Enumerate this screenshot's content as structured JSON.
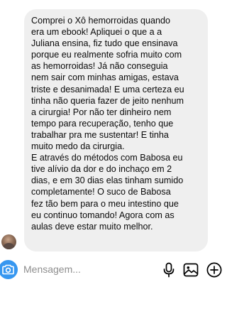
{
  "message": {
    "lines": [
      "Comprei o Xô hemorroidas quando",
      "era um ebook! Apliquei o que a a",
      "Juliana ensina, fiz tudo que ensinava",
      "porque eu realmente sofria muito com",
      "as hemorroidas! Já não conseguia",
      "nem sair com minhas amigas, estava",
      "triste e desanimada! E uma certeza eu",
      "tinha não queria fazer de jeito nenhum",
      "a cirurgia! Por não ter dinheiro nem",
      "tempo para recuperação, tenho que",
      "trabalhar pra me sustentar! E tinha",
      "muito medo da cirurgia.",
      "E através do métodos com Babosa eu",
      "tive alívio da dor e do inchaço em 2",
      "dias, e em 30 dias elas tinham sumido",
      "completamente! O suco de Babosa",
      "fez tão bem para o meu intestino que",
      "eu continuo tomando! Agora com as",
      "aulas deve estar muito melhor."
    ],
    "bubble_color": "#efefef"
  },
  "composer": {
    "placeholder": "Mensagem...",
    "camera_icon": "camera-icon",
    "accent_color": "#3797f0",
    "right_icons": [
      "microphone-icon",
      "image-icon",
      "plus-circle-icon"
    ]
  }
}
